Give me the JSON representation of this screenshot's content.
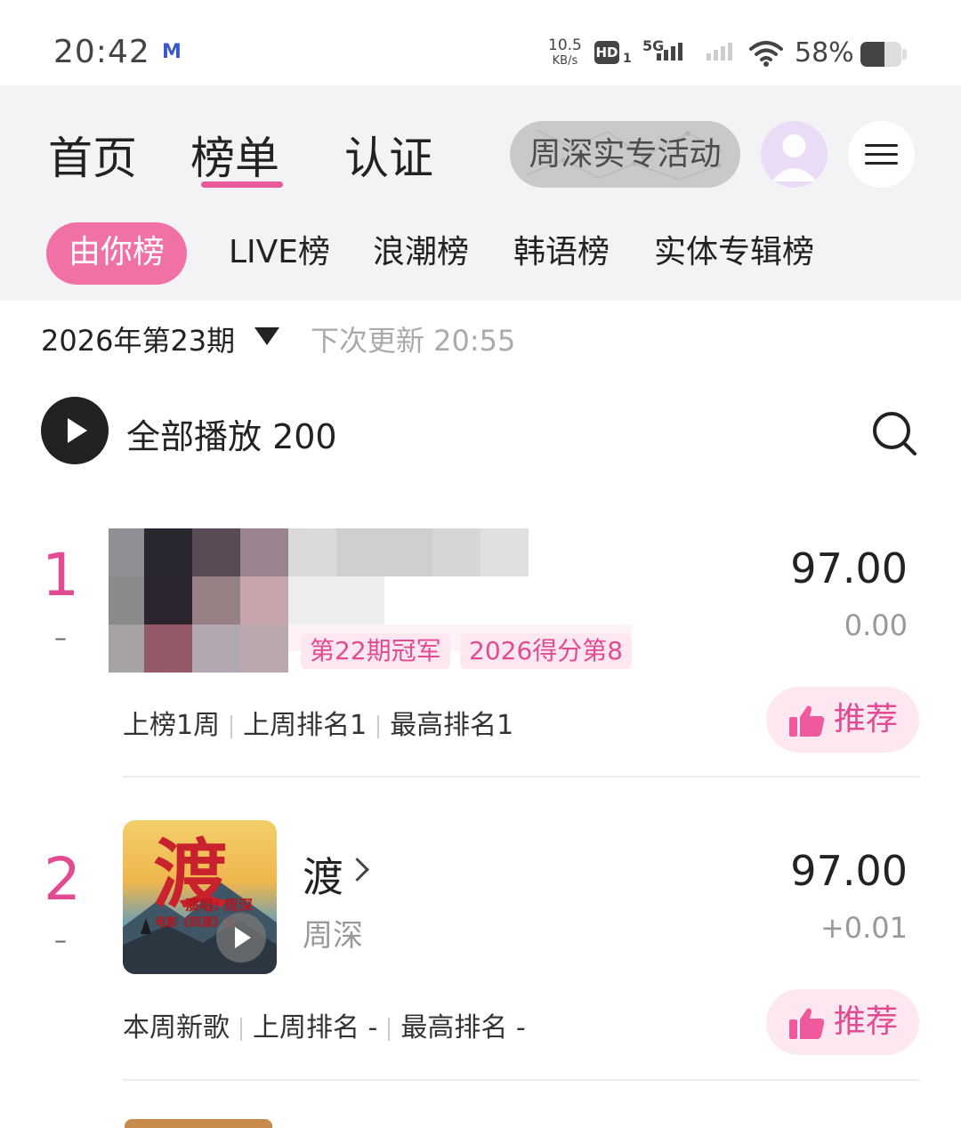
{
  "status_bar": {
    "time": "20:42",
    "app_icon": "M",
    "net_speed_value": "10.5",
    "net_speed_unit": "KB/s",
    "hd": "HD",
    "hd_sub": "1",
    "network": "5G",
    "battery": "58%",
    "battery_level": 0.58
  },
  "top_nav": {
    "tabs": [
      "首页",
      "榜单",
      "认证"
    ],
    "active_tab": "榜单",
    "promo_label": "周深实专活动"
  },
  "chart_tabs": {
    "items": [
      "由你榜",
      "LIVE榜",
      "浪潮榜",
      "韩语榜",
      "实体专辑榜"
    ],
    "active": "由你榜"
  },
  "period": {
    "label": "2026年第23期",
    "next_update": "下次更新 20:55"
  },
  "play_all": {
    "label": "全部播放 200"
  },
  "entries": [
    {
      "rank": "1",
      "change": "–",
      "score": "97.00",
      "delta": "0.00",
      "tags": [
        "第22期冠军",
        "2026得分第8"
      ],
      "meta": [
        "上榜1周",
        "上周排名1",
        "最高排名1"
      ],
      "recommend_label": "推荐"
    },
    {
      "rank": "2",
      "change": "–",
      "title": "渡",
      "artist": "周深",
      "cover_title": "渡",
      "cover_sub": "演唱: 周深",
      "cover_sub2": "电影《四渡》主",
      "score": "97.00",
      "delta": "+0.01",
      "meta": [
        "本周新歌",
        "上周排名 -",
        "最高排名 -"
      ],
      "recommend_label": "推荐"
    }
  ],
  "colors": {
    "accent": "#e24a91",
    "chip_active": "#f071a6",
    "header_bg": "#f3f3f5"
  }
}
